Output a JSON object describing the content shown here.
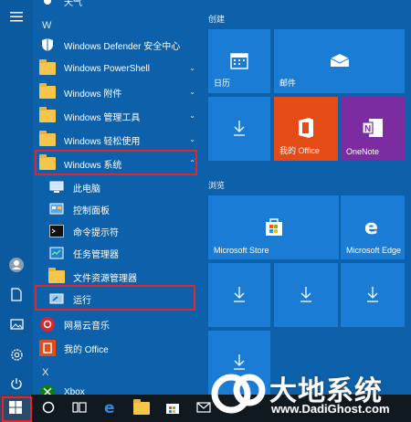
{
  "applist": {
    "section_top_partial": "天气",
    "letter_w": "W",
    "letter_x": "X",
    "items": [
      {
        "label": "Windows Defender 安全中心"
      },
      {
        "label": "Windows PowerShell"
      },
      {
        "label": "Windows 附件"
      },
      {
        "label": "Windows 管理工具"
      },
      {
        "label": "Windows 轻松使用"
      },
      {
        "label": "Windows 系统"
      }
    ],
    "sub_items": [
      {
        "label": "此电脑"
      },
      {
        "label": "控制面板"
      },
      {
        "label": "命令提示符"
      },
      {
        "label": "任务管理器"
      },
      {
        "label": "文件资源管理器"
      },
      {
        "label": "运行"
      }
    ],
    "more_items": [
      {
        "label": "网易云音乐"
      },
      {
        "label": "我的 Office"
      }
    ],
    "x_items": [
      {
        "label": "Xbox"
      }
    ]
  },
  "tiles": {
    "group1": "创建",
    "group2": "浏览",
    "calendar": "日历",
    "mail": "邮件",
    "office": "我的 Office",
    "onenote": "OneNote",
    "store": "Microsoft Store",
    "edge": "Microsoft Edge"
  },
  "watermark": {
    "big": "大地系统",
    "small": "www.DadiGhost.com"
  },
  "colors": {
    "accent": "#0d61ab",
    "tile": "#1b7cd6",
    "office": "#e54b17",
    "onenote": "#7b2ca1",
    "highlight_box": "#e3262e"
  }
}
